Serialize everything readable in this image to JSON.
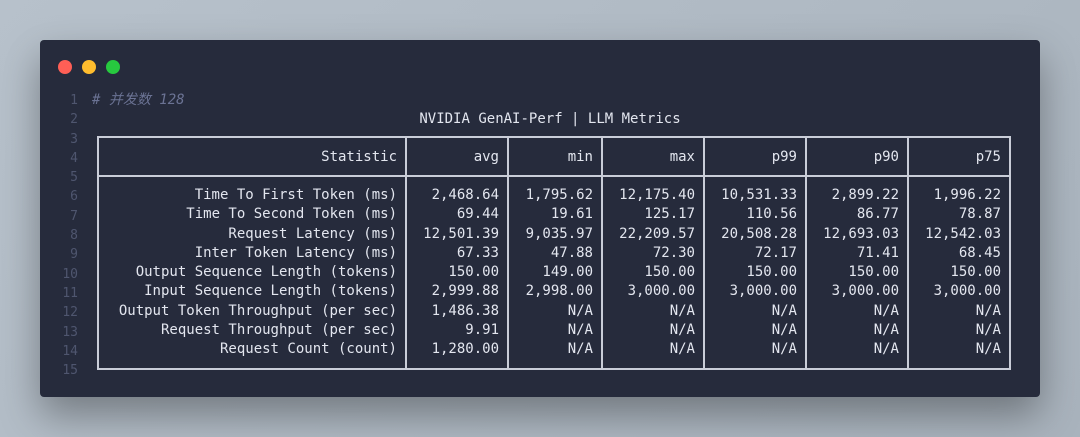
{
  "window": {
    "buttons": [
      "close",
      "minimize",
      "maximize"
    ]
  },
  "line_numbers": [
    "1",
    "2",
    "3",
    "4",
    "5",
    "6",
    "7",
    "8",
    "9",
    "10",
    "11",
    "12",
    "13",
    "14",
    "15"
  ],
  "comment": "# 并发数 128",
  "title": "NVIDIA GenAI-Perf | LLM Metrics",
  "table": {
    "headers": [
      "Statistic",
      "avg",
      "min",
      "max",
      "p99",
      "p90",
      "p75"
    ],
    "rows": [
      [
        "Time To First Token (ms)",
        "2,468.64",
        "1,795.62",
        "12,175.40",
        "10,531.33",
        "2,899.22",
        "1,996.22"
      ],
      [
        "Time To Second Token (ms)",
        "69.44",
        "19.61",
        "125.17",
        "110.56",
        "86.77",
        "78.87"
      ],
      [
        "Request Latency (ms)",
        "12,501.39",
        "9,035.97",
        "22,209.57",
        "20,508.28",
        "12,693.03",
        "12,542.03"
      ],
      [
        "Inter Token Latency (ms)",
        "67.33",
        "47.88",
        "72.30",
        "72.17",
        "71.41",
        "68.45"
      ],
      [
        "Output Sequence Length (tokens)",
        "150.00",
        "149.00",
        "150.00",
        "150.00",
        "150.00",
        "150.00"
      ],
      [
        "Input Sequence Length (tokens)",
        "2,999.88",
        "2,998.00",
        "3,000.00",
        "3,000.00",
        "3,000.00",
        "3,000.00"
      ],
      [
        "Output Token Throughput (per sec)",
        "1,486.38",
        "N/A",
        "N/A",
        "N/A",
        "N/A",
        "N/A"
      ],
      [
        "Request Throughput (per sec)",
        "9.91",
        "N/A",
        "N/A",
        "N/A",
        "N/A",
        "N/A"
      ],
      [
        "Request Count (count)",
        "1,280.00",
        "N/A",
        "N/A",
        "N/A",
        "N/A",
        "N/A"
      ]
    ]
  },
  "colors": {
    "window_bg": "#262b3c",
    "text": "#e3e6ef",
    "line_number": "#4f566f",
    "comment": "#6b7394",
    "border": "#c9cdd8"
  }
}
